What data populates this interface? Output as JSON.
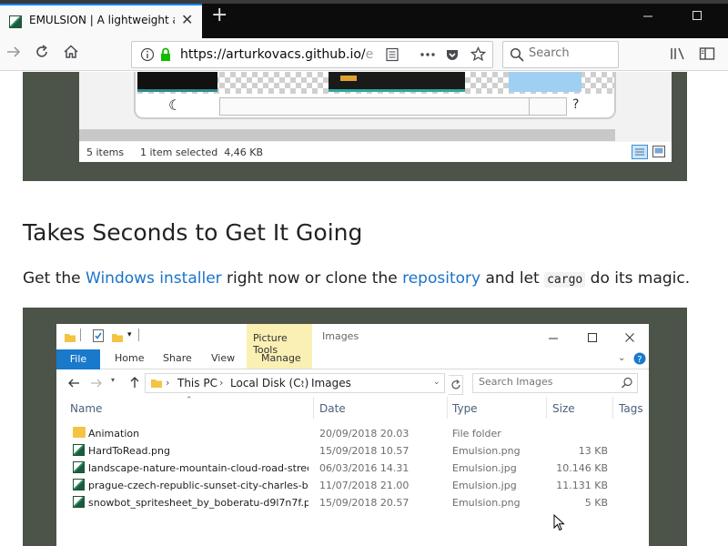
{
  "browser": {
    "tab_title": "EMULSION | A lightweight and",
    "tab_close": "✕",
    "new_tab": "+",
    "url_main": "https://arturkovacs.github.io/",
    "url_dim": "e",
    "search_placeholder": "Search"
  },
  "top_shot": {
    "moon_symbol": "☾",
    "help_symbol": "?",
    "status_items": "5 items",
    "status_selected": "1 item selected  4,46 KB"
  },
  "section": {
    "heading": "Takes Seconds to Get It Going",
    "p_pre": "Get the ",
    "p_link1": "Windows installer",
    "p_mid1": " right now or clone the ",
    "p_link2": "repository",
    "p_mid2": " and let ",
    "p_code": "cargo",
    "p_post": " do its magic."
  },
  "explorer": {
    "context_tab": "Picture Tools",
    "title": "Images",
    "tabs": {
      "file": "File",
      "home": "Home",
      "share": "Share",
      "view": "View",
      "manage": "Manage"
    },
    "crumbs": [
      "This PC",
      "Local Disk (C:)",
      "Images"
    ],
    "search_placeholder": "Search Images",
    "columns": {
      "name": "Name",
      "date": "Date",
      "type": "Type",
      "size": "Size",
      "tags": "Tags"
    },
    "rows": [
      {
        "name": "Animation",
        "date": "20/09/2018 20.03",
        "type": "File folder",
        "size": "",
        "icon": "folder-icon"
      },
      {
        "name": "HardToRead.png",
        "date": "15/09/2018 10.57",
        "type": "Emulsion.png",
        "size": "13 KB",
        "icon": "emulsion-file-icon"
      },
      {
        "name": "landscape-nature-mountain-cloud-road-street-...",
        "date": "06/03/2016 14.31",
        "type": "Emulsion.jpg",
        "size": "10.146 KB",
        "icon": "emulsion-file-icon"
      },
      {
        "name": "prague-czech-republic-sunset-city-charles-brid...",
        "date": "11/07/2018 21.00",
        "type": "Emulsion.jpg",
        "size": "11.131 KB",
        "icon": "emulsion-file-icon"
      },
      {
        "name": "snowbot_spritesheet_by_boberatu-d9l7n7f.png",
        "date": "15/09/2018 20.57",
        "type": "Emulsion.png",
        "size": "5 KB",
        "icon": "emulsion-file-icon"
      }
    ]
  }
}
